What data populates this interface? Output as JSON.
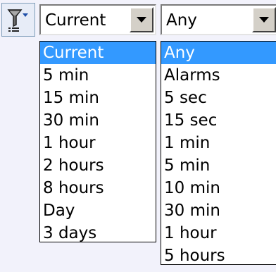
{
  "toolbar": {
    "filter_icon": "filter-funnel-icon"
  },
  "period_combo": {
    "value": "Current",
    "options": [
      "Current",
      "5 min",
      "15 min",
      "30 min",
      "1 hour",
      "2 hours",
      "8 hours",
      "Day",
      "3 days"
    ],
    "selected_index": 0
  },
  "interval_combo": {
    "value": "Any",
    "options": [
      "Any",
      "Alarms",
      "5 sec",
      "15 sec",
      "1 min",
      "5 min",
      "10 min",
      "30 min",
      "1 hour",
      "5 hours"
    ],
    "selected_index": 0
  },
  "colors": {
    "selection": "#3399ff",
    "background": "#f2f2fb",
    "icon_blue": "#1f4fa8"
  }
}
